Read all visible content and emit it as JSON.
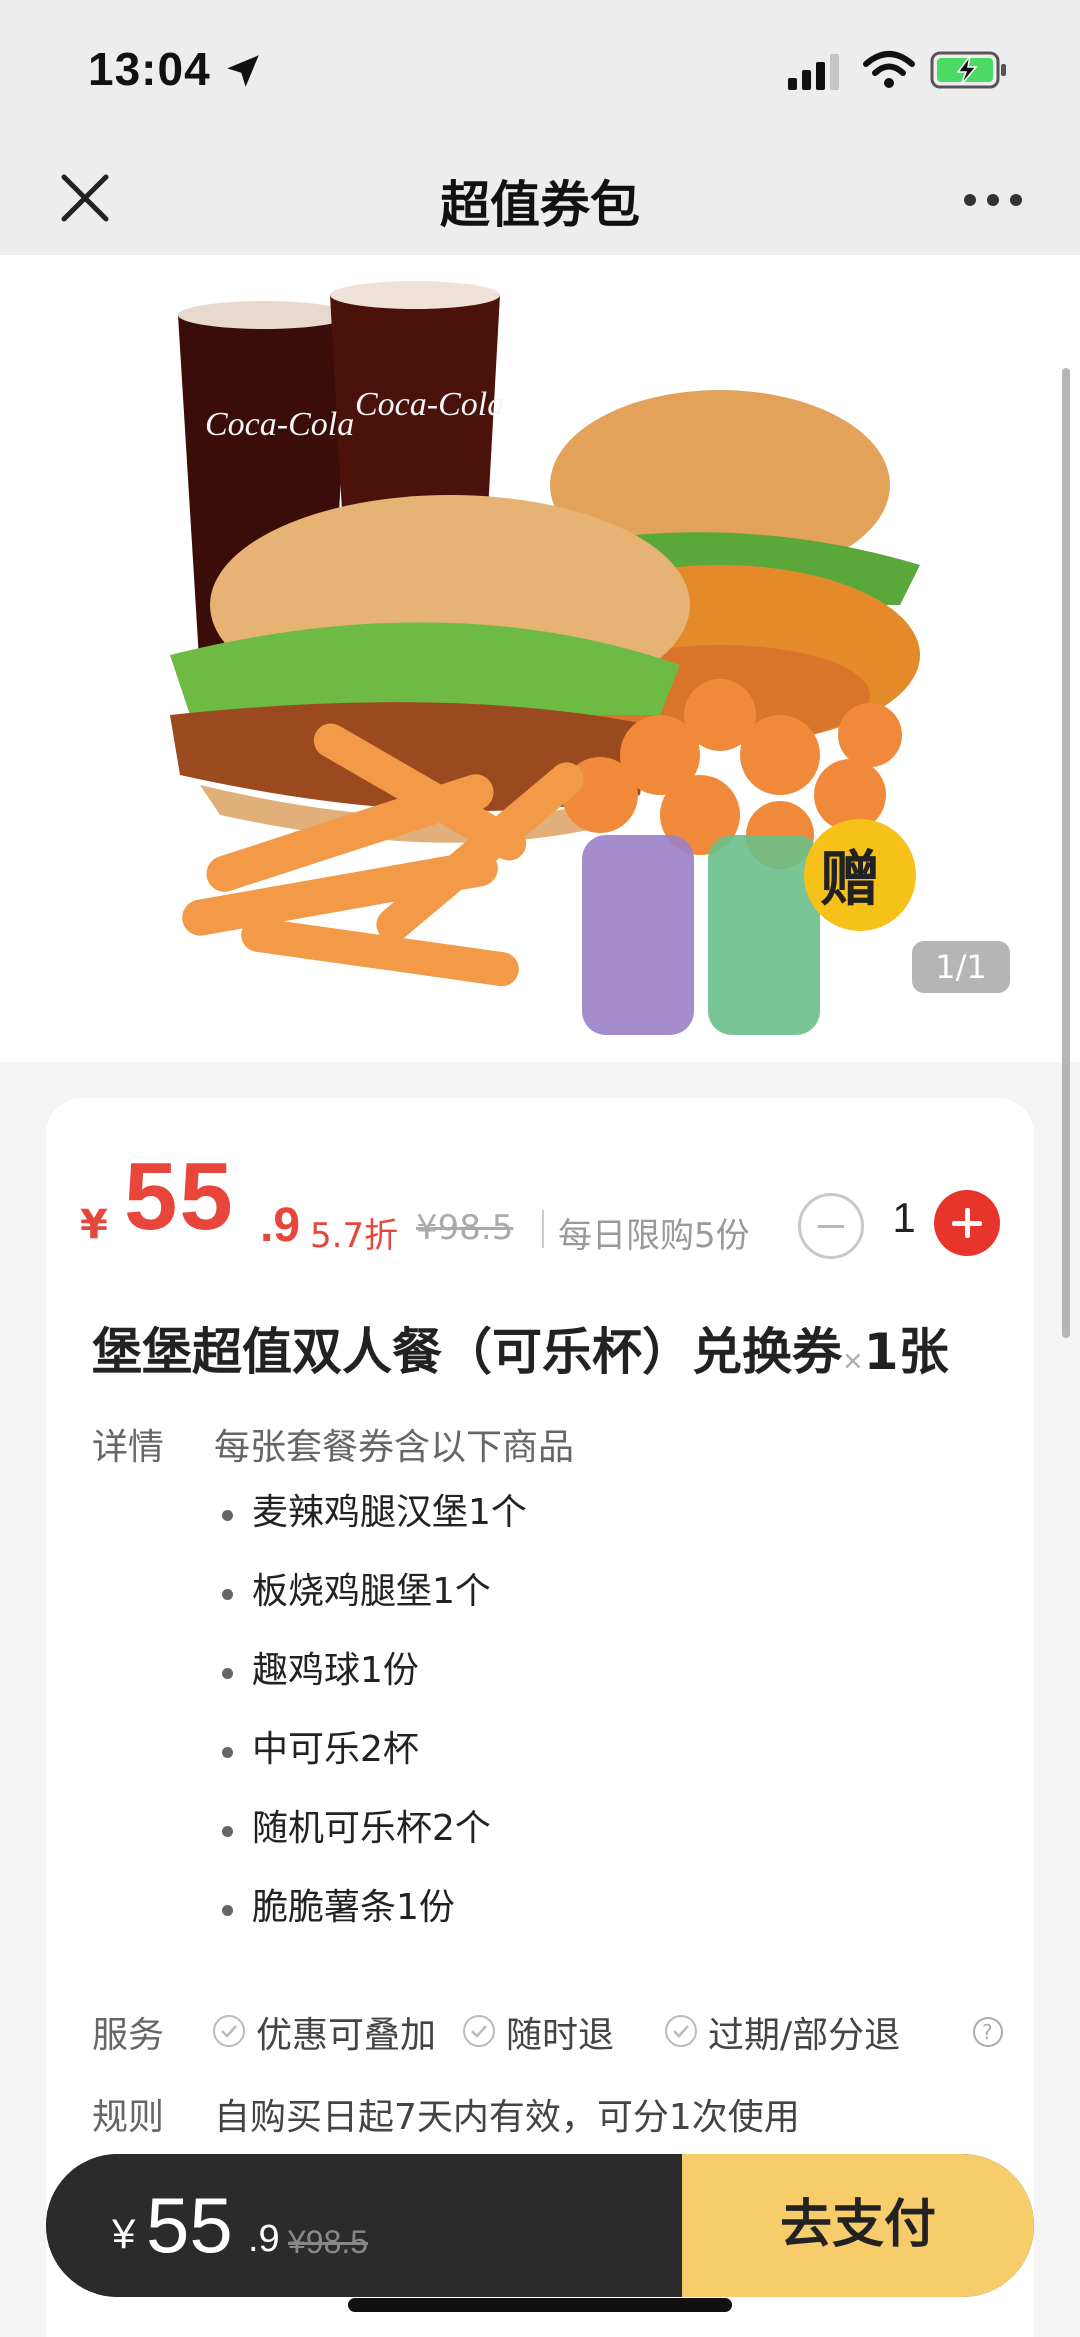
{
  "status_bar": {
    "time": "13:04"
  },
  "nav": {
    "title": "超值券包"
  },
  "hero": {
    "image_counter": "1/1",
    "cup_brand": "Coca-Cola",
    "gift_badge": "赠"
  },
  "price": {
    "currency": "¥",
    "integer": "55",
    "decimal": ".9",
    "discount": "5.7折",
    "original": "¥98.5",
    "limit": "每日限购5份",
    "quantity": "1"
  },
  "product": {
    "title": "堡堡超值双人餐（可乐杯）兑换券",
    "multiplier": "×",
    "count": "1张"
  },
  "details": {
    "label": "详情",
    "description": "每张套餐券含以下商品",
    "items": [
      "麦辣鸡腿汉堡1个",
      "板烧鸡腿堡1个",
      "趣鸡球1份",
      "中可乐2杯",
      "随机可乐杯2个",
      "脆脆薯条1份"
    ]
  },
  "service": {
    "label": "服务",
    "tags": [
      "优惠可叠加",
      "随时退",
      "过期/部分退"
    ]
  },
  "rule": {
    "label": "规则",
    "text": "自购买日起7天内有效，可分1次使用"
  },
  "pay_bar": {
    "currency": "¥",
    "integer": "55",
    "decimal": ".9",
    "original": "¥98.5",
    "button": "去支付"
  },
  "colors": {
    "accent_red": "#e8463b",
    "pay_button": "#f7cd6b",
    "pay_bar_bg": "#2b2b2b"
  }
}
